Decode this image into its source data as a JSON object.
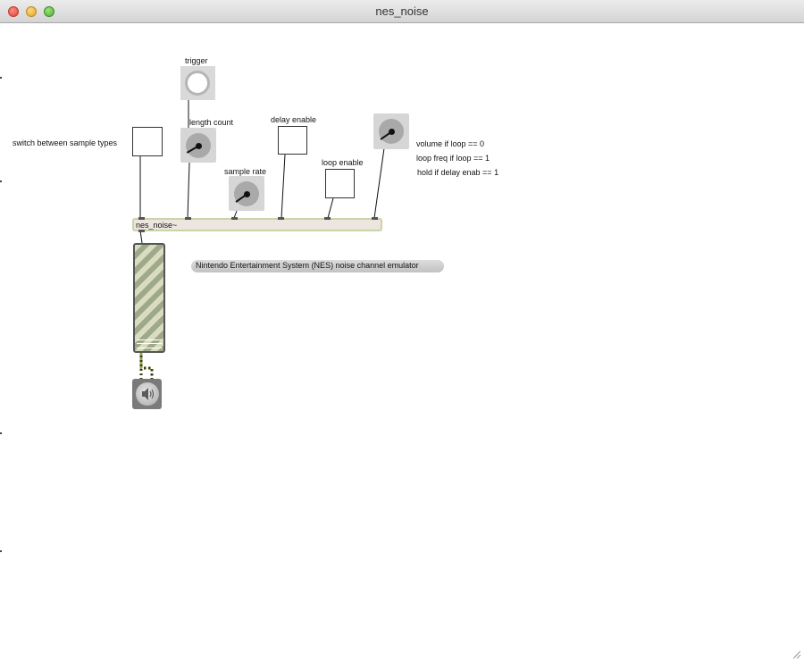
{
  "window": {
    "title": "nes_noise"
  },
  "patch": {
    "labels": {
      "trigger": "trigger",
      "length_count": "length count",
      "sample_rate": "sample rate",
      "delay_enable": "delay enable",
      "loop_enable": "loop enable",
      "switch_sample_types": "switch between sample types",
      "volume_note_1": "volume if loop == 0",
      "volume_note_2": "loop freq if loop == 1",
      "volume_note_3": "hold if delay enab == 1"
    },
    "object_box": {
      "text": "nes_noise~"
    },
    "description": "Nintendo Entertainment System (NES) noise channel emulator"
  },
  "colors": {
    "object_fill": "#ece5e0",
    "object_border": "#c9d4a8",
    "signal_cord": "#9aa64b",
    "control_cord": "#111111"
  },
  "icons": {
    "bang": "trigger-bang-icon",
    "dial": "dial-icon",
    "speaker": "speaker-icon"
  }
}
